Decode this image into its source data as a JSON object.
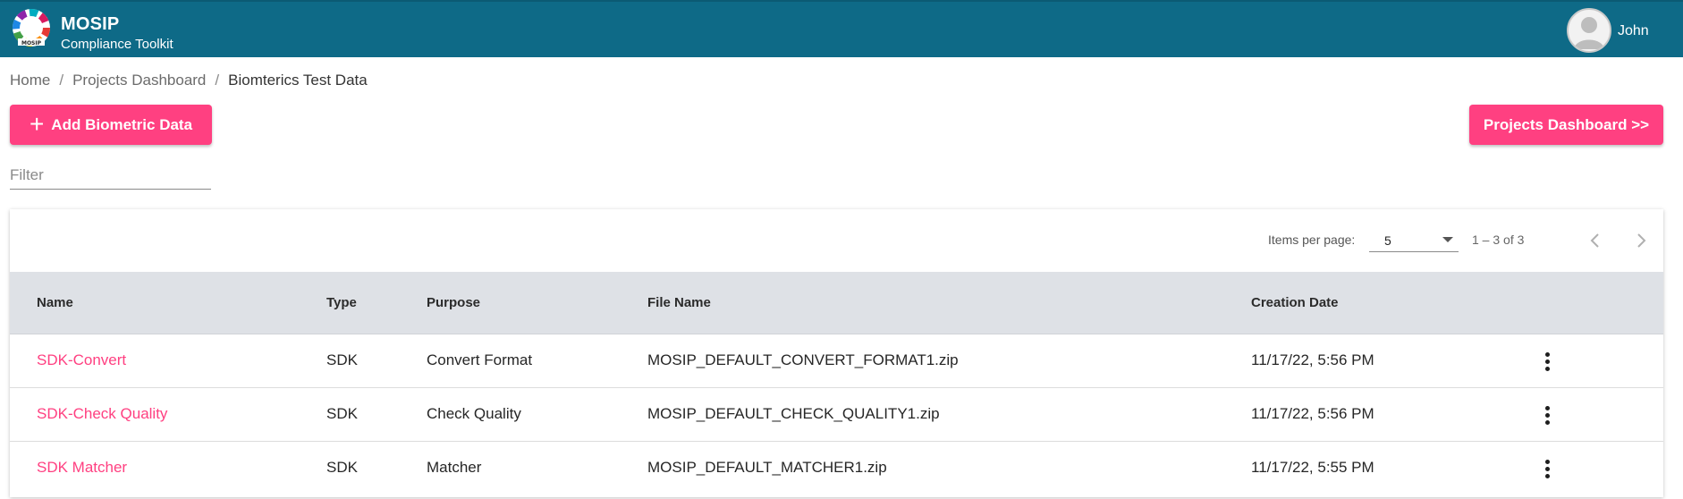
{
  "header": {
    "brand_title": "MOSIP",
    "brand_subtitle": "Compliance Toolkit",
    "logo_icon": "mosip-logo-icon",
    "user_name": "John",
    "bar_color": "#0e6a87"
  },
  "breadcrumb": {
    "items": [
      "Home",
      "Projects Dashboard",
      "Biomterics Test Data"
    ],
    "separator": "/"
  },
  "actions": {
    "add_label": "Add Biometric Data",
    "add_icon": "+",
    "dashboard_label": "Projects Dashboard >>",
    "accent_color": "#ff4081"
  },
  "filter": {
    "placeholder": "Filter",
    "value": ""
  },
  "paginator": {
    "items_per_page_label": "Items per page:",
    "items_per_page_value": "5",
    "range_label": "1 – 3 of 3",
    "prev_icon": "chevron-left-icon",
    "next_icon": "chevron-right-icon"
  },
  "table": {
    "columns": [
      "Name",
      "Type",
      "Purpose",
      "File Name",
      "Creation Date"
    ],
    "rows": [
      {
        "name": "SDK-Convert",
        "type": "SDK",
        "purpose": "Convert Format",
        "file_name": "MOSIP_DEFAULT_CONVERT_FORMAT1.zip",
        "creation_date": "11/17/22, 5:56 PM"
      },
      {
        "name": "SDK-Check Quality",
        "type": "SDK",
        "purpose": "Check Quality",
        "file_name": "MOSIP_DEFAULT_CHECK_QUALITY1.zip",
        "creation_date": "11/17/22, 5:56 PM"
      },
      {
        "name": "SDK Matcher",
        "type": "SDK",
        "purpose": "Matcher",
        "file_name": "MOSIP_DEFAULT_MATCHER1.zip",
        "creation_date": "11/17/22, 5:55 PM"
      }
    ],
    "row_menu_icon": "more-vert-icon"
  }
}
